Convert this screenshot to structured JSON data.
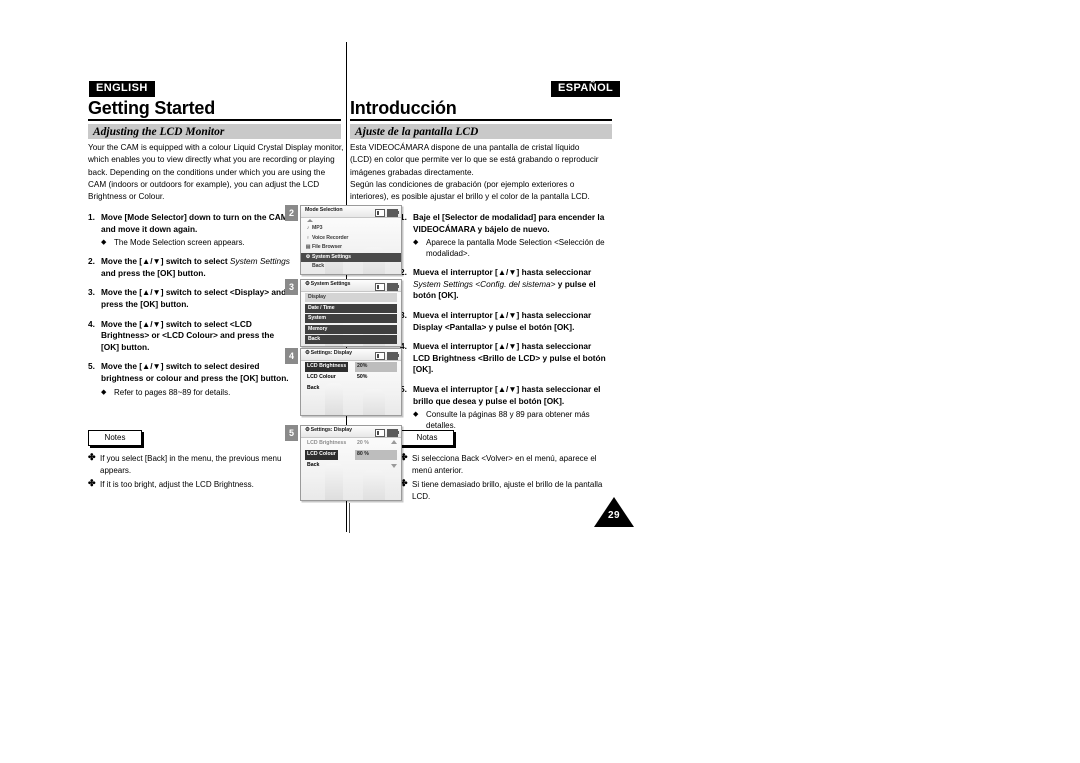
{
  "english": {
    "language_badge": "ENGLISH",
    "chapter_title": "Getting Started",
    "section_title": "Adjusting the LCD Monitor",
    "intro": "Your the CAM is equipped with a colour Liquid Crystal Display monitor, which enables you to view directly what you are recording or playing back. Depending on the conditions under which you are using the CAM (indoors or outdoors for example), you can adjust the LCD Brightness or Colour.",
    "steps": [
      {
        "number": "1.",
        "text": "Move [Mode Selector] down to turn on the CAM and move it down again.",
        "substeps": [
          "The Mode Selection screen appears."
        ]
      },
      {
        "number": "2.",
        "text_pre": "Move the [▲/▼] switch to select ",
        "text_italic": "System Settings",
        "text_post": " and press the [OK] button.",
        "substeps": []
      },
      {
        "number": "3.",
        "text": "Move the [▲/▼] switch to select <Display> and press the [OK] button.",
        "substeps": []
      },
      {
        "number": "4.",
        "text": "Move the [▲/▼] switch to select <LCD Brightness> or <LCD Colour> and press the [OK] button.",
        "substeps": []
      },
      {
        "number": "5.",
        "text": "Move the [▲/▼] switch to select desired brightness or colour and press the [OK] button.",
        "substeps": [
          "Refer to pages 88~89 for details."
        ]
      }
    ],
    "notes_label": "Notes",
    "notes": [
      "If you select [Back] in the menu, the previous menu appears.",
      "If it is too bright, adjust the LCD Brightness."
    ]
  },
  "spanish": {
    "language_badge": "ESPAÑOL",
    "chapter_title": "Introducción",
    "section_title": "Ajuste de la pantalla LCD",
    "intro_lines": [
      "Esta VIDEOCÁMARA dispone de una pantalla de cristal líquido",
      "(LCD) en color que permite ver lo que se está grabando o reproducir",
      "imágenes grabadas directamente.",
      "Según las condiciones de grabación (por ejemplo exteriores o",
      "interiores), es posible ajustar el brillo y el color de la pantalla LCD."
    ],
    "steps": [
      {
        "number": "1.",
        "text": "Baje el [Selector de modalidad] para encender la VIDEOCÁMARA y bájelo de nuevo.",
        "substeps": [
          "Aparece la pantalla Mode Selection <Selección de modalidad>."
        ]
      },
      {
        "number": "2.",
        "text_pre": "Mueva el interruptor [▲/▼] hasta seleccionar ",
        "text_italic": "System Settings <Config. del sistema>",
        "text_post": " y pulse el botón [OK].",
        "substeps": []
      },
      {
        "number": "3.",
        "text": "Mueva el interruptor [▲/▼] hasta seleccionar Display <Pantalla> y pulse el botón [OK].",
        "substeps": []
      },
      {
        "number": "4.",
        "text": "Mueva el interruptor [▲/▼] hasta seleccionar LCD Brightness <Brillo de LCD> y pulse el botón [OK].",
        "substeps": []
      },
      {
        "number": "5.",
        "text": "Mueva el interruptor [▲/▼] hasta seleccionar el brillo que desea y pulse el botón [OK].",
        "substeps": [
          "Consulte la páginas 88 y 89 para obtener más detalles."
        ]
      }
    ],
    "notes_label": "Notas",
    "notes": [
      "Si selecciona Back <Volver> en el menú, aparece el menú anterior.",
      "Si tiene demasiado brillo, ajuste el brillo de la pantalla LCD."
    ]
  },
  "lcd_screens": [
    {
      "badge": "2",
      "title": "Mode Selection",
      "icons": [
        "memory-card-icon",
        "battery-icon"
      ],
      "rows": [
        {
          "icon": "♪",
          "label": "MP3",
          "selected": false
        },
        {
          "icon": "♀",
          "label": "Voice Recorder",
          "selected": false
        },
        {
          "icon": "▤",
          "label": "File Browser",
          "selected": false
        },
        {
          "icon": "⚙",
          "label": "System Settings",
          "selected": true
        },
        {
          "icon": "",
          "label": "Back",
          "selected": false
        }
      ]
    },
    {
      "badge": "3",
      "title": "System Settings",
      "icons": [
        "memory-card-icon",
        "battery-icon"
      ],
      "rows": [
        {
          "label": "Display",
          "style": "lite"
        },
        {
          "label": "Date / Time",
          "style": "dark"
        },
        {
          "label": "System",
          "style": "dark"
        },
        {
          "label": "Memory",
          "style": "dark"
        },
        {
          "label": "Back",
          "style": "dark"
        }
      ]
    },
    {
      "badge": "4",
      "title": "Settings: Display",
      "icons": [
        "memory-card-icon",
        "battery-icon"
      ],
      "rows": [
        {
          "label": "LCD Brightness",
          "value": "20%",
          "highlight": "both"
        },
        {
          "label": "LCD Colour",
          "value": "50%",
          "highlight": "none"
        },
        {
          "label": "Back",
          "value": "",
          "highlight": "none"
        }
      ]
    },
    {
      "badge": "5",
      "title": "Settings: Display",
      "icons": [
        "memory-card-icon",
        "battery-icon"
      ],
      "rows": [
        {
          "label": "LCD Brightness",
          "value": "20 %",
          "highlight": "dim"
        },
        {
          "label": "LCD Colour",
          "value": "80 %",
          "highlight": "both"
        },
        {
          "label": "Back",
          "value": "",
          "highlight": "none"
        }
      ],
      "scroll_arrows": true
    }
  ],
  "page_number": "29"
}
